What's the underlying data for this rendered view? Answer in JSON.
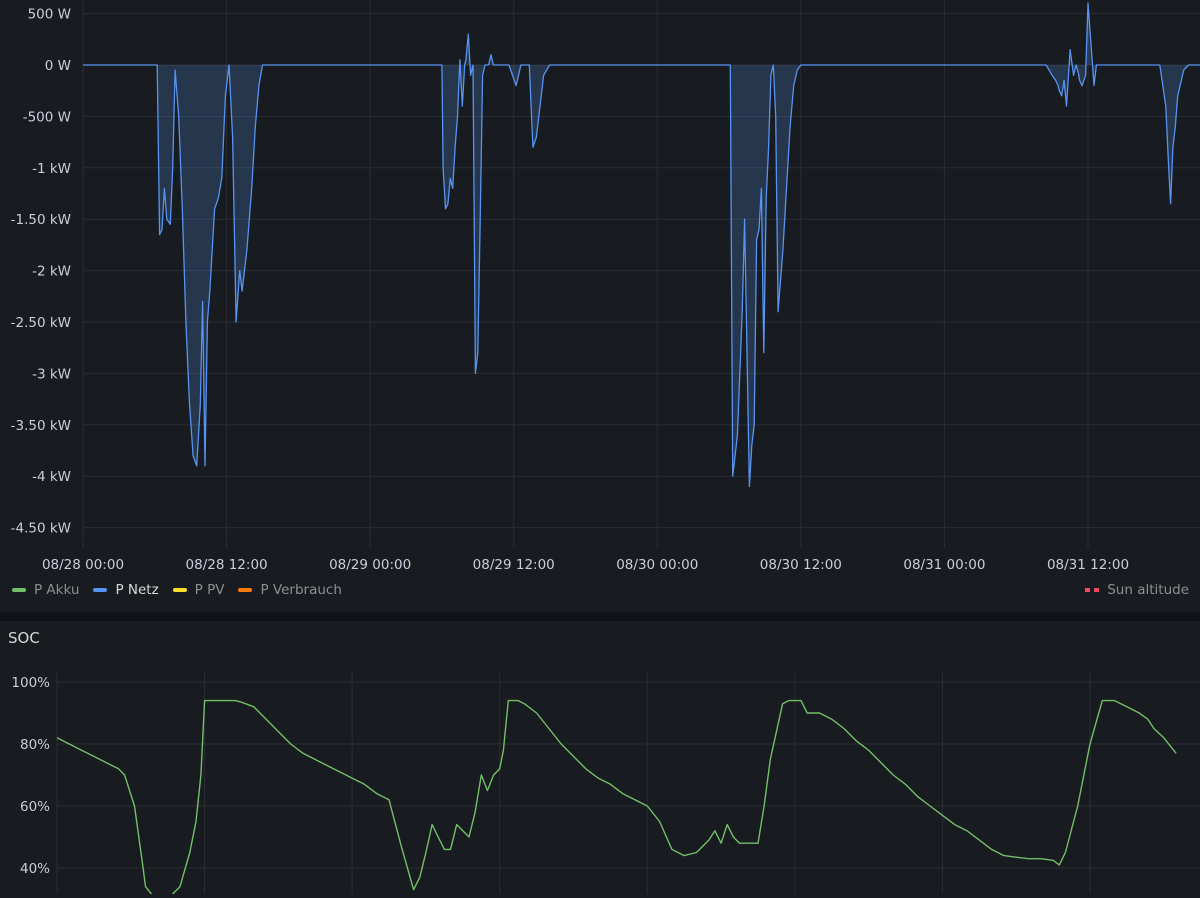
{
  "colors": {
    "background": "#181b1f",
    "grid": "#2a2d33",
    "axis_text": "#ccccdc",
    "p_akku": "#73bf69",
    "p_netz": "#5794f2",
    "p_pv": "#fade2a",
    "p_verbrauch": "#ff780a",
    "sun_altitude": "#f2495c"
  },
  "power_panel": {
    "legend": [
      {
        "label": "P Akku",
        "color": "#73bf69",
        "active": false
      },
      {
        "label": "P Netz",
        "color": "#5794f2",
        "active": true
      },
      {
        "label": "P PV",
        "color": "#fade2a",
        "active": false
      },
      {
        "label": "P Verbrauch",
        "color": "#ff780a",
        "active": false
      }
    ],
    "legend_right": {
      "label": "Sun altitude",
      "color": "#f2495c",
      "dashed": true
    }
  },
  "soc_panel": {
    "title": "SOC"
  },
  "chart_data": [
    {
      "type": "area",
      "title": "",
      "xlabel": "",
      "ylabel": "",
      "x_ticks": [
        "08/28 00:00",
        "08/28 12:00",
        "08/29 00:00",
        "08/29 12:00",
        "08/30 00:00",
        "08/30 12:00",
        "08/31 00:00",
        "08/31 12:00"
      ],
      "y_ticks": [
        "500 W",
        "0 W",
        "-500 W",
        "-1 kW",
        "-1.50 kW",
        "-2 kW",
        "-2.50 kW",
        "-3 kW",
        "-3.50 kW",
        "-4 kW",
        "-4.50 kW"
      ],
      "ylim": [
        -4600,
        600
      ],
      "grid": true,
      "legend_placement": "bottom",
      "series": [
        {
          "name": "P Netz",
          "color": "#5794f2",
          "x_hours": [
            0,
            6.2,
            6.4,
            6.6,
            6.8,
            7.0,
            7.3,
            7.5,
            7.7,
            8.0,
            8.3,
            8.6,
            8.9,
            9.2,
            9.5,
            9.8,
            10.0,
            10.2,
            10.4,
            10.6,
            10.8,
            11.0,
            11.3,
            11.6,
            11.9,
            12.2,
            12.5,
            12.8,
            13.1,
            13.3,
            13.5,
            13.7,
            13.9,
            14.1,
            14.4,
            14.7,
            15.0,
            15.3,
            15.6,
            15.8,
            16.0,
            17.0,
            20.0,
            24.0,
            28.0,
            30.0,
            30.1,
            30.3,
            30.5,
            30.7,
            30.9,
            31.1,
            31.3,
            31.5,
            31.7,
            31.9,
            32.0,
            32.2,
            32.4,
            32.6,
            32.8,
            33.0,
            33.2,
            33.4,
            33.6,
            33.8,
            33.9,
            34.1,
            34.3,
            34.5,
            35.0,
            35.6,
            36.2,
            36.6,
            36.9,
            37.3,
            37.6,
            37.9,
            38.2,
            38.5,
            39.0,
            40.0,
            43.0,
            48.0,
            51.0,
            53.0,
            54.0,
            54.1,
            54.3,
            54.5,
            54.7,
            54.9,
            55.1,
            55.3,
            55.5,
            55.7,
            55.9,
            56.1,
            56.3,
            56.5,
            56.7,
            56.9,
            57.1,
            57.3,
            57.5,
            57.7,
            57.9,
            58.1,
            58.3,
            58.5,
            58.7,
            58.9,
            59.1,
            59.4,
            59.7,
            60.0,
            60.3,
            60.6,
            60.9,
            61.2,
            61.5,
            62.0,
            64.0,
            68.0,
            72.0,
            76.0,
            79.0,
            80.0,
            80.5,
            81.0,
            81.3,
            81.5,
            81.6,
            81.8,
            82.0,
            82.2,
            82.5,
            82.8,
            83.0,
            83.2,
            83.3,
            83.5,
            83.8,
            84.0,
            84.5,
            84.7,
            85.0,
            86.0,
            87.0,
            88.0,
            89.0,
            90.0,
            90.5,
            90.7,
            90.9,
            91.1,
            91.3,
            91.5,
            91.8,
            92.0,
            92.4,
            92.8,
            93.5,
            94.5,
            95.5,
            96.0
          ],
          "values": [
            0,
            0,
            -1650,
            -1600,
            -1200,
            -1500,
            -1550,
            -1000,
            -50,
            -500,
            -1400,
            -2500,
            -3300,
            -3800,
            -3900,
            -3300,
            -2300,
            -3900,
            -2500,
            -2200,
            -1800,
            -1400,
            -1300,
            -1100,
            -300,
            0,
            -700,
            -2500,
            -2000,
            -2200,
            -2000,
            -1800,
            -1500,
            -1200,
            -600,
            -200,
            0,
            0,
            0,
            0,
            0,
            0,
            0,
            0,
            0,
            0,
            -1000,
            -1400,
            -1350,
            -1100,
            -1200,
            -800,
            -500,
            50,
            -400,
            0,
            50,
            300,
            -100,
            0,
            -3000,
            -2800,
            -1500,
            -100,
            0,
            0,
            0,
            100,
            0,
            0,
            0,
            0,
            -200,
            0,
            0,
            0,
            -800,
            -700,
            -400,
            -100,
            0,
            0,
            0,
            0,
            0,
            0,
            0,
            0,
            -4000,
            -3800,
            -3600,
            -3000,
            -2400,
            -1500,
            -2800,
            -4100,
            -3700,
            -3500,
            -1700,
            -1600,
            -1200,
            -2800,
            -1300,
            -800,
            -100,
            0,
            -500,
            -2400,
            -2100,
            -1800,
            -1400,
            -1000,
            -600,
            -200,
            -50,
            0,
            0,
            0,
            0,
            0,
            0,
            0,
            0,
            0,
            0,
            0,
            0,
            0,
            0,
            -100,
            -150,
            -200,
            -250,
            -300,
            -150,
            -400,
            150,
            -100,
            0,
            -80,
            -150,
            -200,
            -100,
            600,
            -200,
            0,
            0,
            0,
            0,
            0,
            0,
            0,
            -400,
            -900,
            -1350,
            -800,
            -600,
            -300,
            -150,
            -50,
            0,
            0,
            0,
            0,
            0,
            0
          ]
        }
      ]
    },
    {
      "type": "line",
      "title": "SOC",
      "xlabel": "",
      "ylabel": "",
      "y_ticks": [
        "100%",
        "80%",
        "60%",
        "40%"
      ],
      "ylim": [
        35,
        100
      ],
      "grid": true,
      "series": [
        {
          "name": "P Akku",
          "color": "#73bf69",
          "x_hours": [
            0,
            1,
            2,
            3,
            4,
            5,
            5.5,
            6.3,
            7.0,
            7.2,
            8.0,
            9.0,
            10.0,
            10.8,
            11.3,
            11.7,
            12.0,
            13.0,
            14.0,
            14.5,
            15.0,
            16.0,
            17.0,
            18.0,
            19.0,
            20.0,
            21.0,
            22.0,
            23.0,
            24.0,
            25.0,
            26.0,
            27.0,
            28.0,
            29.0,
            29.5,
            30.0,
            30.5,
            31.0,
            31.5,
            32.0,
            32.5,
            33.0,
            33.5,
            34.0,
            34.5,
            35.0,
            35.5,
            36.0,
            36.3,
            36.7,
            37.0,
            37.5,
            38.0,
            39.0,
            40.0,
            41.0,
            42.0,
            43.0,
            44.0,
            45.0,
            46.0,
            47.0,
            48.0,
            49.0,
            50.0,
            51.0,
            52.0,
            53.0,
            53.5,
            54.0,
            54.5,
            55.0,
            55.5,
            56.0,
            56.5,
            57.0,
            57.5,
            58.0,
            59.0,
            59.5,
            60.0,
            60.5,
            61.0,
            61.5,
            62.0,
            63.0,
            64.0,
            65.0,
            66.0,
            67.0,
            68.0,
            69.0,
            70.0,
            71.0,
            72.0,
            73.0,
            74.0,
            75.0,
            76.0,
            77.0,
            78.0,
            79.0,
            80.0,
            81.0,
            81.5,
            82.0,
            83.0,
            84.0,
            85.0,
            86.0,
            87.0,
            88.0,
            88.7,
            89.2,
            90.0,
            91.0,
            92.0,
            93.0,
            94.0,
            95.0,
            96.0
          ],
          "values": [
            82,
            80,
            78,
            76,
            74,
            72,
            70,
            60,
            40,
            34,
            30,
            30,
            34,
            45,
            55,
            70,
            94,
            94,
            94,
            94,
            93.5,
            92,
            88,
            84,
            80,
            77,
            75,
            73,
            71,
            69,
            67,
            64,
            62,
            47,
            33,
            37,
            45,
            54,
            50,
            46,
            46,
            54,
            52,
            50,
            58,
            70,
            65,
            70,
            72,
            78,
            94,
            94,
            94,
            93,
            90,
            85,
            80,
            76,
            72,
            69,
            67,
            64,
            62,
            60,
            55,
            46,
            44,
            45,
            49,
            52,
            48,
            54,
            50,
            48,
            48,
            48,
            48,
            60,
            75,
            93,
            94,
            94,
            94,
            90,
            90,
            90,
            88,
            85,
            81,
            78,
            74,
            70,
            67,
            63,
            60,
            57,
            54,
            52,
            49,
            46,
            44,
            43.5,
            43,
            43,
            42.5,
            41,
            45,
            60,
            80,
            94,
            94,
            92,
            90,
            88,
            85,
            82,
            77
          ]
        }
      ]
    }
  ]
}
